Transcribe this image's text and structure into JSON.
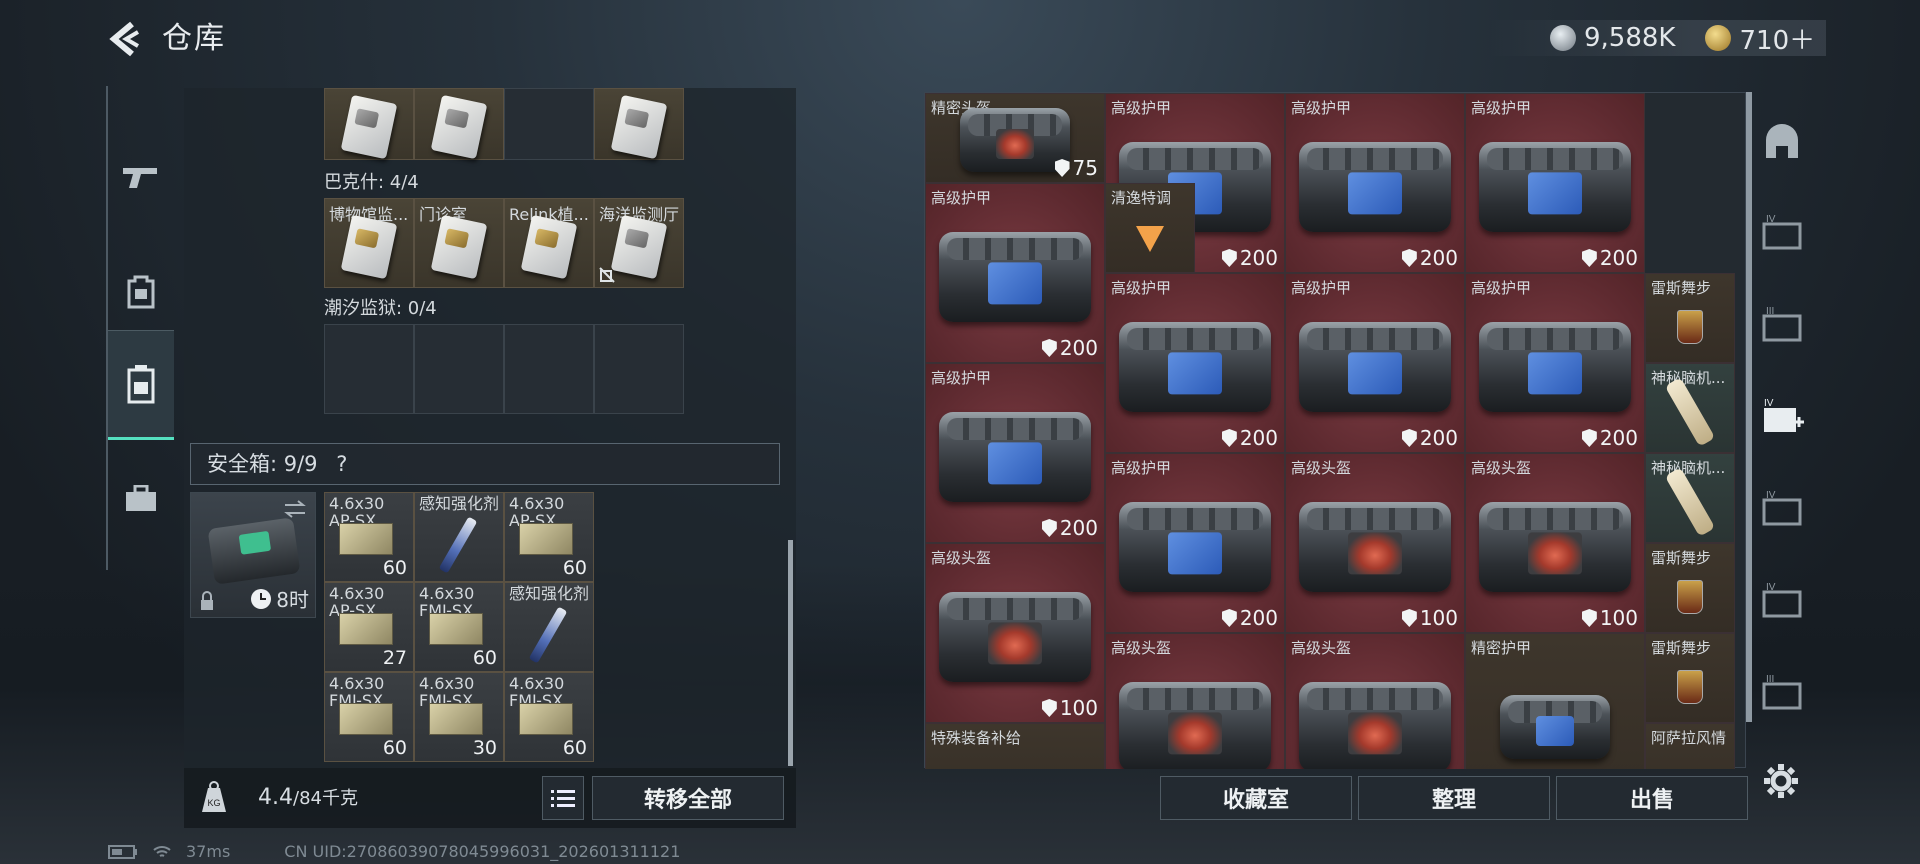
{
  "header": {
    "title": "仓库",
    "currency1": "9,588K",
    "currency2": "710＋",
    "coin1_color": "#9aa3ab",
    "coin2_color": "#c9a24a"
  },
  "left_tabs": [
    "gun-icon",
    "backpack-icon",
    "chest-rig-icon",
    "briefcase-icon"
  ],
  "keys": {
    "row1": [
      {
        "label": ""
      },
      {
        "label": ""
      },
      {
        "label": ""
      },
      {
        "label": ""
      }
    ],
    "bakshi_label": "巴克什: 4/4",
    "row2": [
      {
        "label": "博物馆监..."
      },
      {
        "label": "门诊室"
      },
      {
        "label": "Relink植..."
      },
      {
        "label": "海洋监测厅"
      }
    ],
    "tidal_label": "潮汐监狱: 0/4"
  },
  "safe": {
    "label": "安全箱: 9/9",
    "help": "?",
    "timer": "8时",
    "items": [
      {
        "name": "4.6x30 AP-SX",
        "count": "60",
        "kind": "ammo"
      },
      {
        "name": "感知强化剂",
        "count": "",
        "kind": "syringe"
      },
      {
        "name": "4.6x30 AP-SX",
        "count": "60",
        "kind": "ammo"
      },
      {
        "name": "4.6x30 AP-SX",
        "count": "27",
        "kind": "ammo"
      },
      {
        "name": "4.6x30 FMJ-SX",
        "count": "60",
        "kind": "ammo"
      },
      {
        "name": "感知强化剂",
        "count": "",
        "kind": "syringe"
      },
      {
        "name": "4.6x30 FMJ-SX",
        "count": "60",
        "kind": "ammo"
      },
      {
        "name": "4.6x30 FMJ-SX",
        "count": "30",
        "kind": "ammo"
      },
      {
        "name": "4.6x30 FMJ-SX",
        "count": "60",
        "kind": "ammo"
      }
    ]
  },
  "bottom_left": {
    "weight": "4.4",
    "weight_max": "/84千克",
    "transfer_all": "转移全部"
  },
  "stash": [
    {
      "label": "精密头盔",
      "armor": "75",
      "bg": "brown",
      "kind": "helm-small"
    },
    {
      "label": "高级护甲",
      "armor": "200",
      "bg": "red",
      "kind": "armor"
    },
    {
      "label": "高级护甲",
      "armor": "200",
      "bg": "red",
      "kind": "armor"
    },
    {
      "label": "高级护甲",
      "armor": "200",
      "bg": "red",
      "kind": "armor"
    },
    {
      "label": "高级护甲",
      "armor": "200",
      "bg": "red",
      "kind": "armor"
    },
    {
      "label": "清逸特调",
      "armor": "",
      "bg": "brown",
      "kind": "cocktail"
    },
    {
      "label": "高级护甲",
      "armor": "200",
      "bg": "red",
      "kind": "armor"
    },
    {
      "label": "高级护甲",
      "armor": "200",
      "bg": "red",
      "kind": "armor"
    },
    {
      "label": "高级护甲",
      "armor": "200",
      "bg": "red",
      "kind": "armor"
    },
    {
      "label": "雷斯舞步",
      "armor": "",
      "bg": "brown",
      "kind": "drink"
    },
    {
      "label": "神秘脑机...",
      "armor": "",
      "bg": "teal",
      "kind": "tape"
    },
    {
      "label": "高级护甲",
      "armor": "200",
      "bg": "red",
      "kind": "armor"
    },
    {
      "label": "高级护甲",
      "armor": "200",
      "bg": "red",
      "kind": "armor"
    },
    {
      "label": "高级头盔",
      "armor": "100",
      "bg": "red",
      "kind": "helm"
    },
    {
      "label": "高级头盔",
      "armor": "100",
      "bg": "red",
      "kind": "helm"
    },
    {
      "label": "神秘脑机...",
      "armor": "",
      "bg": "teal",
      "kind": "tape"
    },
    {
      "label": "高级头盔",
      "armor": "100",
      "bg": "red",
      "kind": "helm"
    },
    {
      "label": "雷斯舞步",
      "armor": "",
      "bg": "brown",
      "kind": "drink"
    },
    {
      "label": "高级头盔",
      "armor": "",
      "bg": "red",
      "kind": "helm"
    },
    {
      "label": "高级头盔",
      "armor": "",
      "bg": "red",
      "kind": "helm"
    },
    {
      "label": "精密护甲",
      "armor": "",
      "bg": "brown",
      "kind": "armor-small"
    },
    {
      "label": "雷斯舞步",
      "armor": "",
      "bg": "brown",
      "kind": "drink"
    },
    {
      "label": "特殊装备补给",
      "armor": "",
      "bg": "brown",
      "kind": "none"
    },
    {
      "label": "阿萨拉风情",
      "armor": "",
      "bg": "brown",
      "kind": "none"
    }
  ],
  "stash_buttons": {
    "collection": "收藏室",
    "sort": "整理",
    "sell": "出售"
  },
  "right_tabs": [
    "dome-icon",
    "stash-iv-icon",
    "stash-iii-icon",
    "stash-iv-add-icon",
    "stash-iv-2-icon",
    "stash-iv-3-icon",
    "stash-iii-2-icon"
  ],
  "status": {
    "ping": "37ms",
    "uid": "CN UID:270860390780459960​31_202601311121"
  }
}
